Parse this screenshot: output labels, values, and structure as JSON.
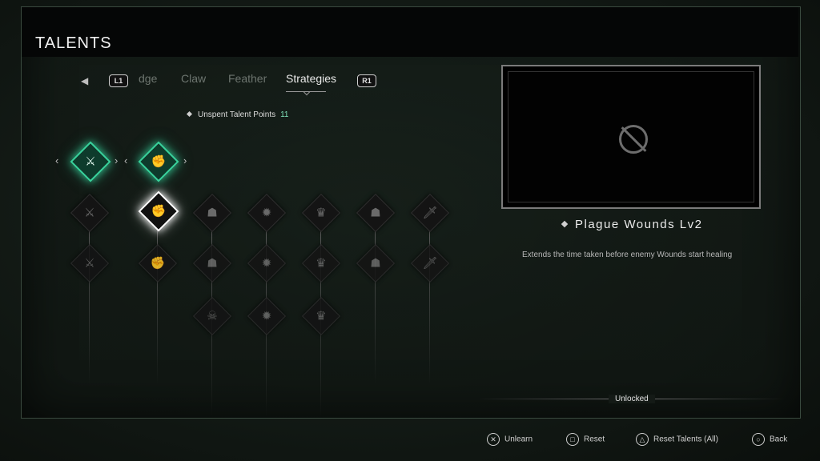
{
  "header": {
    "title": "TALENTS"
  },
  "tabs": {
    "left_button": "L1",
    "right_button": "R1",
    "items": [
      "dge",
      "Claw",
      "Feather",
      "Strategies"
    ],
    "active": "Strategies"
  },
  "talent_points": {
    "label": "Unspent Talent Points",
    "value": "11"
  },
  "tree": {
    "icons": [
      "axe-icon",
      "fist-icon",
      "hood-icon",
      "gear-icon",
      "crown-icon",
      "hood-icon",
      "sword-icon",
      "skull-icon"
    ],
    "accent_color": "#39d29c"
  },
  "detail": {
    "name": "Plague Wounds Lv2",
    "description": "Extends the time taken before enemy Wounds start healing",
    "status": "Unlocked"
  },
  "footer": {
    "unlearn": {
      "symbol": "✕",
      "label": "Unlearn"
    },
    "reset": {
      "symbol": "□",
      "label": "Reset"
    },
    "reset_all": {
      "symbol": "△",
      "label": "Reset Talents (All)"
    },
    "back": {
      "symbol": "○",
      "label": "Back"
    }
  }
}
